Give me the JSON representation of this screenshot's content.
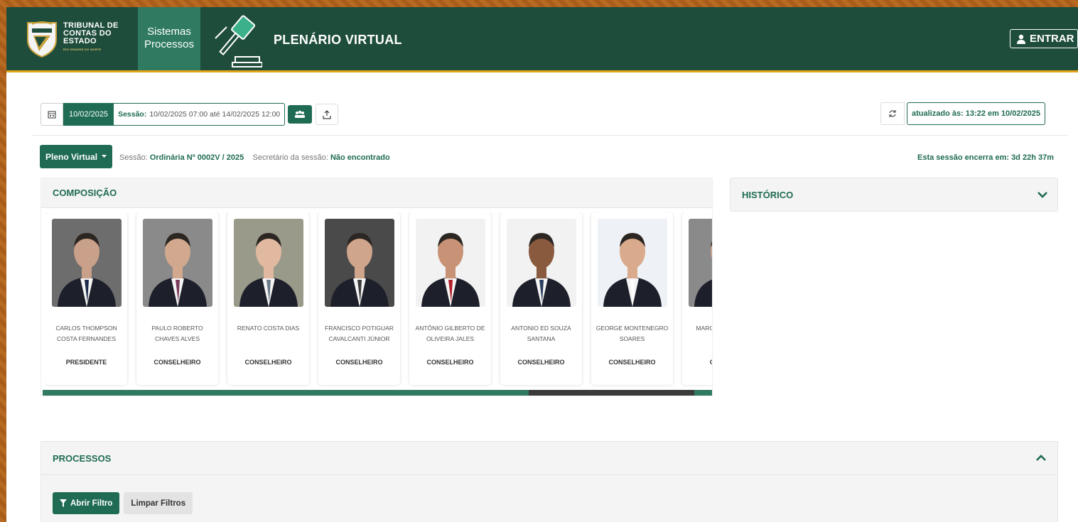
{
  "header": {
    "brand_line1": "TRIBUNAL DE",
    "brand_line2": "CONTAS DO",
    "brand_line3": "ESTADO",
    "brand_sub": "RIO GRANDE DO NORTE",
    "sistemas_line1": "Sistemas",
    "sistemas_line2": "Processos",
    "app_title": "PLENÁRIO VIRTUAL",
    "login_label": "ENTRAR"
  },
  "toolbar": {
    "date": "10/02/2025",
    "session_label": "Sessão:",
    "session_range": "10/02/2025 07:00 até 14/02/2025 12:00",
    "updated_text": "atualizado às: 13:22 em 10/02/2025"
  },
  "session": {
    "plenary_label": "Pleno Virtual",
    "session_prefix": "Sessão:",
    "session_name": "Ordinária Nº 0002V / 2025",
    "secretary_prefix": "Secretário da sessão:",
    "secretary_value": "Não encontrado",
    "ends_text": "Esta sessão encerra em: 3d 22h 37m"
  },
  "composicao": {
    "title": "COMPOSIÇÃO",
    "members": [
      {
        "name": "CARLOS THOMPSON COSTA FERNANDES",
        "role": "PRESIDENTE",
        "tie": "#1d2a4a",
        "bg": "#6d6d6d"
      },
      {
        "name": "PAULO ROBERTO CHAVES ALVES",
        "role": "CONSELHEIRO",
        "tie": "#7a3a5a",
        "bg": "#8a8a8a"
      },
      {
        "name": "RENATO COSTA DIAS",
        "role": "CONSELHEIRO",
        "tie": "#6a7a8a",
        "bg": "#9a9a8a"
      },
      {
        "name": "FRANCISCO POTIGUAR CAVALCANTI JÚNIOR",
        "role": "CONSELHEIRO",
        "tie": "#3a3a3a",
        "bg": "#4a4a4a"
      },
      {
        "name": "ANTÔNIO GILBERTO DE OLIVEIRA JALES",
        "role": "CONSELHEIRO",
        "tie": "#b21e2b",
        "bg": "#f2f2f2"
      },
      {
        "name": "ANTONIO ED SOUZA SANTANA",
        "role": "CONSELHEIRO",
        "tie": "#2c3e60",
        "bg": "#f2f2f2"
      },
      {
        "name": "GEORGE MONTENEGRO SOARES",
        "role": "CONSELHEIRO",
        "tie": "#ffffff",
        "bg": "#eef1f5"
      },
      {
        "name": "MARCO MON MON",
        "role": "CON SUI",
        "tie": "#3a3a3a",
        "bg": "#8a8a8a"
      }
    ]
  },
  "historico": {
    "title": "HISTÓRICO"
  },
  "processos": {
    "title": "PROCESSOS",
    "open_filter": "Abrir Filtro",
    "clear_filters": "Limpar Filtros"
  },
  "colors": {
    "header_bg": "#1f4d3c",
    "accent": "#1f6b53",
    "header_border": "#e0a31b"
  }
}
